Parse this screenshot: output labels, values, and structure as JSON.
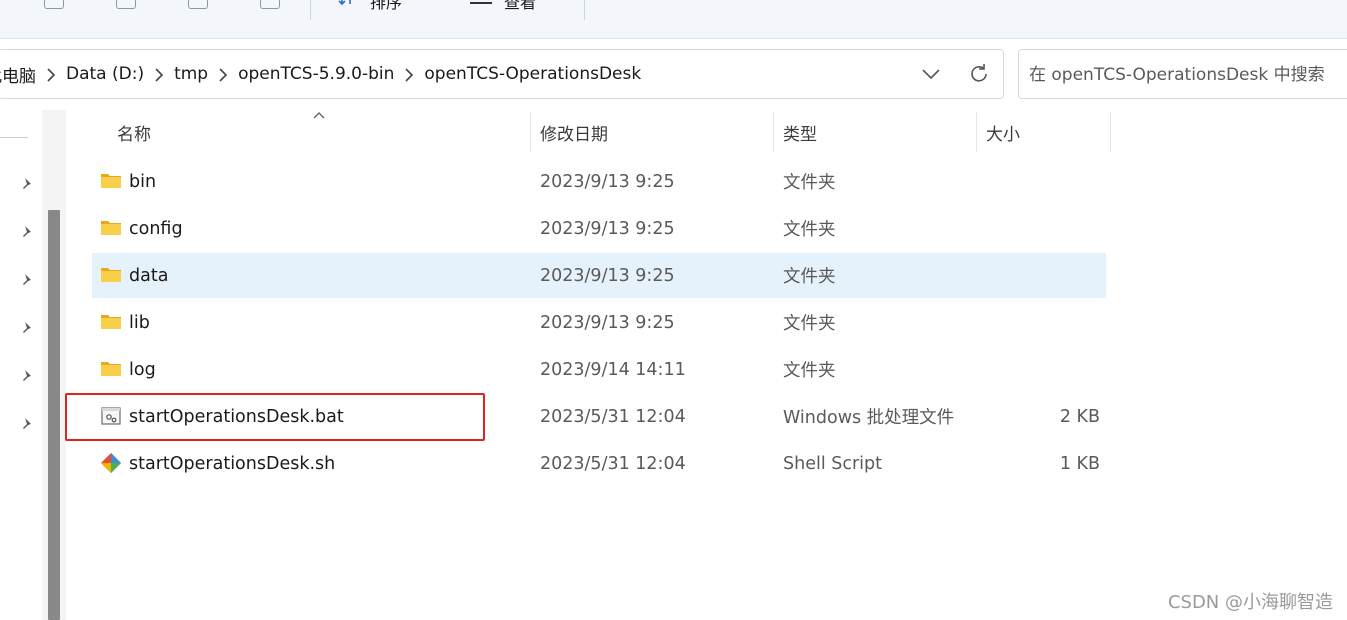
{
  "toolbar": {
    "sort_label": "排序",
    "view_label": "查看"
  },
  "address_bar": {
    "crumbs": [
      "此电脑",
      "Data (D:)",
      "tmp",
      "openTCS-5.9.0-bin",
      "openTCS-OperationsDesk"
    ]
  },
  "search": {
    "placeholder": "在 openTCS-OperationsDesk 中搜索"
  },
  "columns": {
    "name": "名称",
    "date": "修改日期",
    "type": "类型",
    "size": "大小"
  },
  "files": [
    {
      "name": "bin",
      "date": "2023/9/13 9:25",
      "type": "文件夹",
      "size": "",
      "icon": "folder-icon"
    },
    {
      "name": "config",
      "date": "2023/9/13 9:25",
      "type": "文件夹",
      "size": "",
      "icon": "folder-icon"
    },
    {
      "name": "data",
      "date": "2023/9/13 9:25",
      "type": "文件夹",
      "size": "",
      "icon": "folder-icon",
      "selected": true
    },
    {
      "name": "lib",
      "date": "2023/9/13 9:25",
      "type": "文件夹",
      "size": "",
      "icon": "folder-icon"
    },
    {
      "name": "log",
      "date": "2023/9/14 14:11",
      "type": "文件夹",
      "size": "",
      "icon": "folder-icon"
    },
    {
      "name": "startOperationsDesk.bat",
      "date": "2023/5/31 12:04",
      "type": "Windows 批处理文件",
      "size": "2 KB",
      "icon": "batch-file-icon"
    },
    {
      "name": "startOperationsDesk.sh",
      "date": "2023/5/31 12:04",
      "type": "Shell Script",
      "size": "1 KB",
      "icon": "shell-script-icon"
    }
  ],
  "colors": {
    "selection": "#e5f1fb",
    "highlight_box": "#e0231b",
    "folder": "#f5c542"
  },
  "watermark": "CSDN @小海聊智造"
}
